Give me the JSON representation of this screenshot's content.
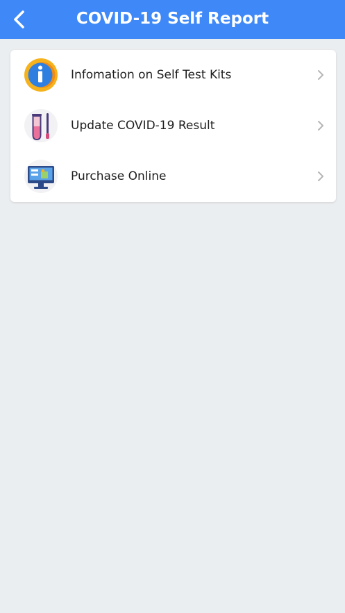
{
  "header": {
    "title": "COVID-19 Self Report",
    "accent_color": "#3e88f7"
  },
  "menu": {
    "items": [
      {
        "label": "Infomation on Self Test Kits",
        "icon": "info-icon"
      },
      {
        "label": "Update COVID-19 Result",
        "icon": "test-tube-icon"
      },
      {
        "label": "Purchase Online",
        "icon": "online-shop-icon"
      }
    ]
  }
}
